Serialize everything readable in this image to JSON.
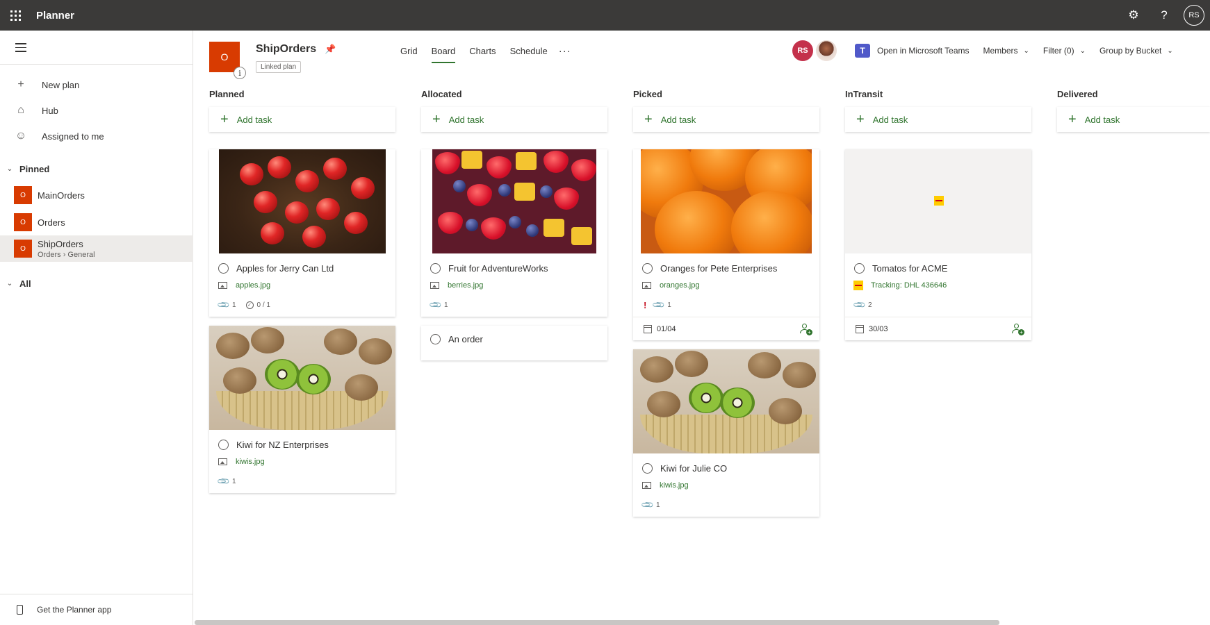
{
  "app": {
    "name": "Planner",
    "user_initials": "RS"
  },
  "topbar": {
    "icons": [
      "waffle-icon",
      "gear-icon",
      "help-icon"
    ]
  },
  "nav": {
    "items": [
      {
        "label": "New plan",
        "icon": "plus-icon"
      },
      {
        "label": "Hub",
        "icon": "home-icon"
      },
      {
        "label": "Assigned to me",
        "icon": "person-icon"
      }
    ],
    "pinned_label": "Pinned",
    "pinned": [
      {
        "label": "MainOrders",
        "tile": "O"
      },
      {
        "label": "Orders",
        "tile": "O"
      },
      {
        "label": "ShipOrders",
        "tile": "O",
        "sub_group": "Orders",
        "sub_channel": "General",
        "selected": true
      }
    ],
    "all_label": "All",
    "get_app": "Get the Planner app"
  },
  "plan": {
    "tile": "O",
    "info": "i",
    "title": "ShipOrders",
    "linked": "Linked plan",
    "tabs": [
      "Grid",
      "Board",
      "Charts",
      "Schedule"
    ],
    "active_tab": "Board",
    "more": "···",
    "member_initials": "RS",
    "teams_label": "Open in Microsoft Teams",
    "members_label": "Members",
    "filter_label": "Filter (0)",
    "group_label": "Group by Bucket"
  },
  "board": {
    "add_task_label": "Add task",
    "buckets": [
      {
        "name": "Planned"
      },
      {
        "name": "Allocated"
      },
      {
        "name": "Picked"
      },
      {
        "name": "InTransit"
      },
      {
        "name": "Delivered"
      }
    ],
    "cards": {
      "apples": {
        "title": "Apples for Jerry Can Ltd",
        "attachment": "apples.jpg",
        "attachments_count": "1",
        "checklist": "0 / 1"
      },
      "kiwi_nz": {
        "title": "Kiwi for NZ Enterprises",
        "attachment": "kiwis.jpg",
        "attachments_count": "1"
      },
      "fruit_aw": {
        "title": "Fruit for AdventureWorks",
        "attachment": "berries.jpg",
        "attachments_count": "1"
      },
      "an_order": {
        "title": "An order"
      },
      "oranges": {
        "title": "Oranges for Pete Enterprises",
        "attachment": "oranges.jpg",
        "priority": "!",
        "attachments_count": "1",
        "due": "01/04"
      },
      "kiwi_julie": {
        "title": "Kiwi for Julie CO",
        "attachment": "kiwis.jpg",
        "attachments_count": "1"
      },
      "tomatos": {
        "title": "Tomatos for ACME",
        "tracking": "Tracking: DHL 436646",
        "attachments_count": "2",
        "due": "30/03"
      }
    }
  },
  "colors": {
    "accent": "#31752f",
    "brand_tile": "#d83b01",
    "topbar": "#3b3a39",
    "priority": "#c50f1f"
  }
}
